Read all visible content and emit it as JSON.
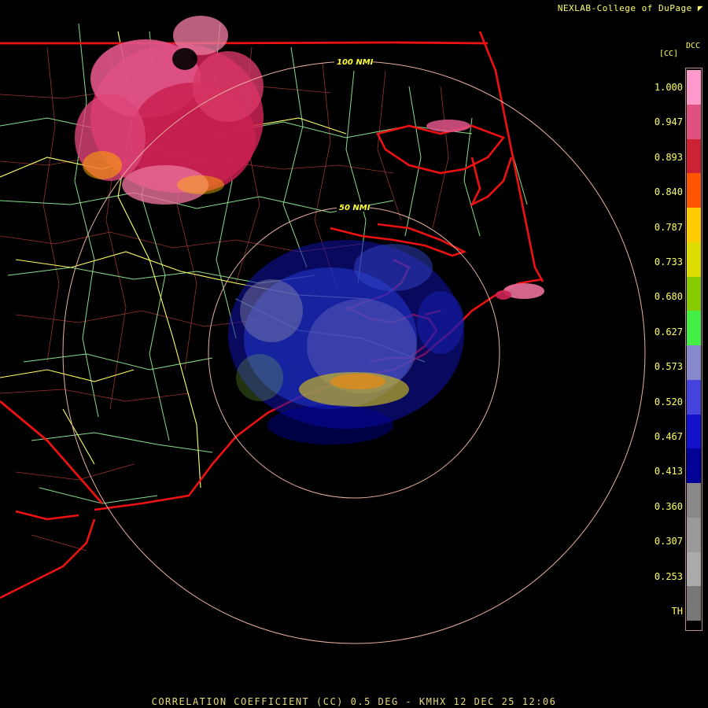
{
  "header": {
    "credit": "NEXLAB-College of DuPage",
    "credit_icon": "logo-mark-icon"
  },
  "footer": {
    "caption": "CORRELATION COEFFICIENT (CC) 0.5 DEG - KMHX 12 DEC 25 12:06"
  },
  "legend": {
    "product": "DCC",
    "unit": "[CC]",
    "labels": [
      "1.000",
      "0.947",
      "0.893",
      "0.840",
      "0.787",
      "0.733",
      "0.680",
      "0.627",
      "0.573",
      "0.520",
      "0.467",
      "0.413",
      "0.360",
      "0.307",
      "0.253",
      "TH"
    ],
    "colors": [
      "#ff99cc",
      "#e05080",
      "#cc2233",
      "#ff5500",
      "#ffcc00",
      "#dddd00",
      "#88cc00",
      "#44ee44",
      "#8888cc",
      "#4444dd",
      "#1111cc",
      "#000099",
      "#888888",
      "#999999",
      "#aaaaaa",
      "#777777"
    ]
  },
  "map": {
    "ring_labels": [
      "100 NMI",
      "50 NMI"
    ],
    "colors": {
      "state_border": "#ee1111",
      "coastline": "#ee1111",
      "county": "#993333",
      "highway": "#ffff66",
      "road": "#88dd88",
      "range_ring": "#e8b0a0"
    }
  }
}
